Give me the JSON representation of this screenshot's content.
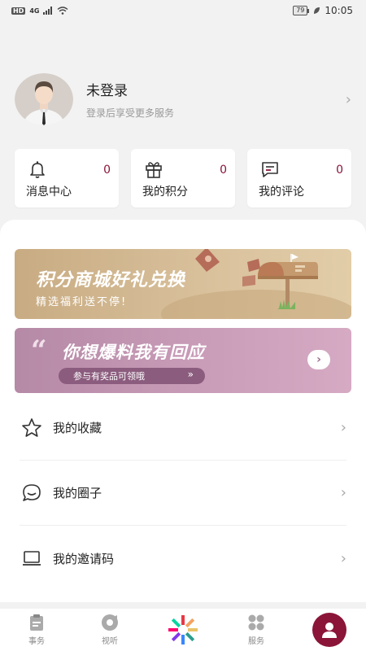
{
  "status_bar": {
    "network": "HD",
    "signal": "4G",
    "battery": "79",
    "time": "10:05"
  },
  "profile": {
    "name": "未登录",
    "subtitle": "登录后享受更多服务"
  },
  "stats": [
    {
      "label": "消息中心",
      "count": "0",
      "icon": "bell-icon"
    },
    {
      "label": "我的积分",
      "count": "0",
      "icon": "gift-icon"
    },
    {
      "label": "我的评论",
      "count": "0",
      "icon": "comment-icon"
    }
  ],
  "banners": {
    "mall": {
      "title": "积分商城好礼兑换",
      "subtitle": "精选福利送不停!"
    },
    "tipoff": {
      "quote": "“",
      "title": "你想爆料我有回应",
      "pill": "参与有奖品可领哦",
      "pill_arrow": "»",
      "go": "›"
    }
  },
  "menu": [
    {
      "label": "我的收藏",
      "icon": "star-icon"
    },
    {
      "label": "我的圈子",
      "icon": "chat-bubble-icon"
    },
    {
      "label": "我的邀请码",
      "icon": "laptop-icon"
    }
  ],
  "tabs": [
    {
      "label": "事务",
      "icon": "clipboard-icon"
    },
    {
      "label": "视听",
      "icon": "video-icon"
    },
    {
      "label": "",
      "icon": "logo-icon"
    },
    {
      "label": "服务",
      "icon": "grid-icon"
    },
    {
      "label": "",
      "icon": "user-icon",
      "active": true
    }
  ],
  "colors": {
    "accent": "#8a1538",
    "banner_gold": "#d8c09b",
    "banner_mauve": "#c79ab6"
  }
}
